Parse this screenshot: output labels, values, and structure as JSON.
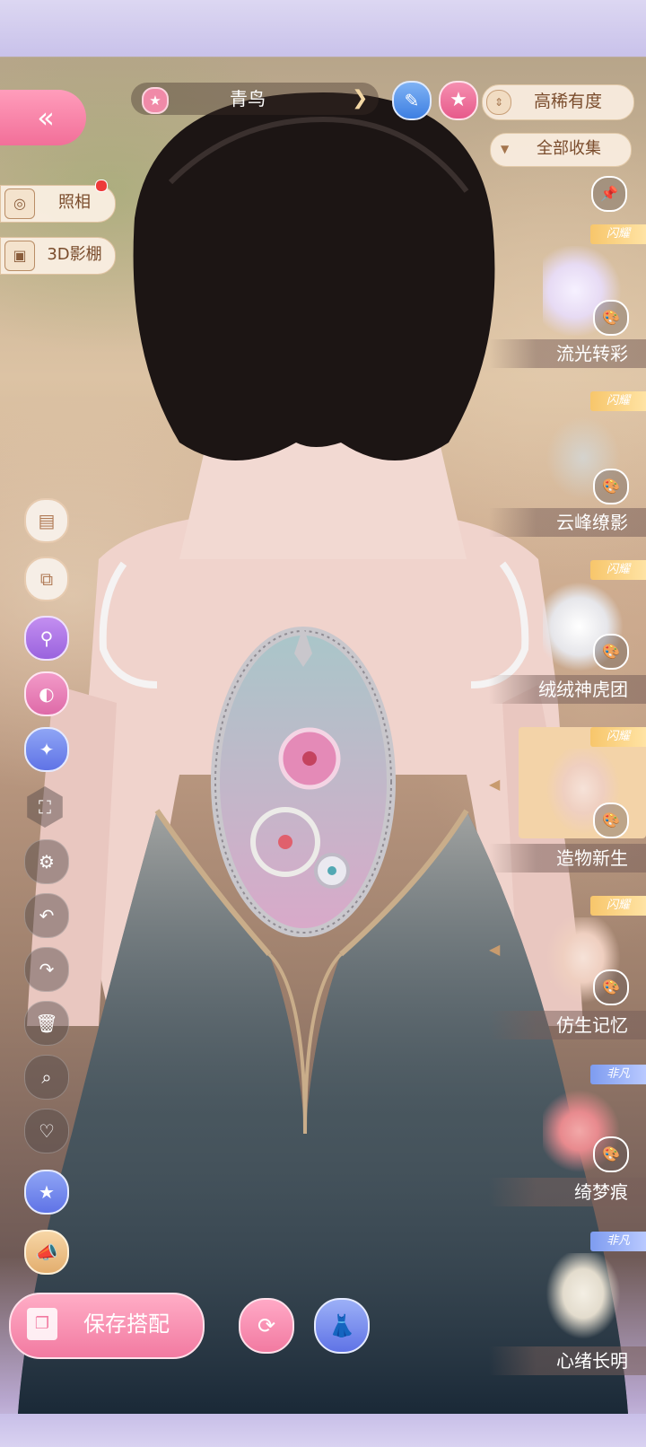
{
  "top_bar": {
    "outfit_name": "青鸟",
    "sort_label": "高稀有度",
    "filter_label": "全部收集"
  },
  "side": {
    "photo_label": "照相",
    "studio_label": "3D影棚"
  },
  "items": [
    {
      "tag": "闪耀",
      "label": "流光转彩"
    },
    {
      "tag": "闪耀",
      "label": "云峰缭影"
    },
    {
      "tag": "闪耀",
      "label": "绒绒神虎团"
    },
    {
      "tag": "闪耀",
      "label": "造物新生"
    },
    {
      "tag": "闪耀",
      "label": "仿生记忆"
    },
    {
      "tag": "非凡",
      "label": "绮梦痕"
    },
    {
      "tag": "非凡",
      "label": "心绪长明"
    }
  ],
  "bottom": {
    "save_label": "保存搭配"
  },
  "colors": {
    "accent_pink": "#f27aa1",
    "accent_blue": "#5f73e6",
    "panel_beige": "#faeee1",
    "text_brown": "#7a4c2c"
  }
}
